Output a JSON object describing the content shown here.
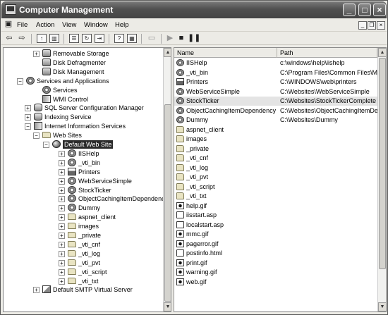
{
  "window": {
    "title": "Computer Management"
  },
  "menu": [
    "File",
    "Action",
    "View",
    "Window",
    "Help"
  ],
  "tree": [
    {
      "label": "Removable Storage",
      "icon": "drive-icon",
      "depth": 2,
      "toggle": "+"
    },
    {
      "label": "Disk Defragmenter",
      "icon": "drive-icon",
      "depth": 2,
      "toggle": ""
    },
    {
      "label": "Disk Management",
      "icon": "drive-icon",
      "depth": 2,
      "toggle": ""
    },
    {
      "label": "Services and Applications",
      "icon": "gear-icon",
      "depth": 0,
      "toggle": "−"
    },
    {
      "label": "Services",
      "icon": "gear-icon",
      "depth": 2,
      "toggle": ""
    },
    {
      "label": "WMI Control",
      "icon": "server-icon",
      "depth": 2,
      "toggle": ""
    },
    {
      "label": "SQL Server Configuration Manager",
      "icon": "db-icon",
      "depth": 1,
      "toggle": "+"
    },
    {
      "label": "Indexing Service",
      "icon": "db-icon",
      "depth": 1,
      "toggle": "+"
    },
    {
      "label": "Internet Information Services",
      "icon": "server-icon",
      "depth": 1,
      "toggle": "−"
    },
    {
      "label": "Web Sites",
      "icon": "folder-icon",
      "depth": 2,
      "toggle": "−"
    },
    {
      "label": "Default Web Site",
      "icon": "globe-icon",
      "depth": 3,
      "toggle": "−",
      "selected": true
    },
    {
      "label": "IISHelp",
      "icon": "gear-icon",
      "depth": 4,
      "toggle": "+"
    },
    {
      "label": "_vti_bin",
      "icon": "gear-icon",
      "depth": 4,
      "toggle": "+"
    },
    {
      "label": "Printers",
      "icon": "printer-icon",
      "depth": 4,
      "toggle": "+"
    },
    {
      "label": "WebServiceSimple",
      "icon": "gear-icon",
      "depth": 4,
      "toggle": "+"
    },
    {
      "label": "StockTicker",
      "icon": "gear-icon",
      "depth": 4,
      "toggle": "+"
    },
    {
      "label": "ObjectCachingItemDependency",
      "icon": "gear-icon",
      "depth": 4,
      "toggle": "+"
    },
    {
      "label": "Dummy",
      "icon": "gear-icon",
      "depth": 4,
      "toggle": "+"
    },
    {
      "label": "aspnet_client",
      "icon": "folder-icon",
      "depth": 4,
      "toggle": "+"
    },
    {
      "label": "images",
      "icon": "folder-icon",
      "depth": 4,
      "toggle": "+"
    },
    {
      "label": "_private",
      "icon": "folder-icon",
      "depth": 4,
      "toggle": "+"
    },
    {
      "label": "_vti_cnf",
      "icon": "folder-icon",
      "depth": 4,
      "toggle": "+"
    },
    {
      "label": "_vti_log",
      "icon": "folder-icon",
      "depth": 4,
      "toggle": "+"
    },
    {
      "label": "_vti_pvt",
      "icon": "folder-icon",
      "depth": 4,
      "toggle": "+"
    },
    {
      "label": "_vti_script",
      "icon": "folder-icon",
      "depth": 4,
      "toggle": "+"
    },
    {
      "label": "_vti_txt",
      "icon": "folder-icon",
      "depth": 4,
      "toggle": "+"
    },
    {
      "label": "Default SMTP Virtual Server",
      "icon": "mail-icon",
      "depth": 2,
      "toggle": "+"
    }
  ],
  "list": {
    "columns": [
      "Name",
      "Path"
    ],
    "rows": [
      {
        "name": "IISHelp",
        "path": "c:\\windows\\help\\iishelp",
        "icon": "gear-icon"
      },
      {
        "name": "_vti_bin",
        "path": "C:\\Program Files\\Common Files\\Mic",
        "icon": "gear-icon"
      },
      {
        "name": "Printers",
        "path": "C:\\WINDOWS\\web\\printers",
        "icon": "printer-icon"
      },
      {
        "name": "WebServiceSimple",
        "path": "C:\\Websites\\WebServiceSimple",
        "icon": "gear-icon"
      },
      {
        "name": "StockTicker",
        "path": "C:\\Websites\\StockTickerComplete",
        "icon": "gear-icon",
        "highlight": true
      },
      {
        "name": "ObjectCachingItemDependency",
        "path": "C:\\Websites\\ObjectCachingItemDe",
        "icon": "gear-icon"
      },
      {
        "name": "Dummy",
        "path": "C:\\Websites\\Dummy",
        "icon": "gear-icon"
      },
      {
        "name": "aspnet_client",
        "path": "",
        "icon": "folder-icon"
      },
      {
        "name": "images",
        "path": "",
        "icon": "folder-icon"
      },
      {
        "name": "_private",
        "path": "",
        "icon": "folder-icon"
      },
      {
        "name": "_vti_cnf",
        "path": "",
        "icon": "folder-icon"
      },
      {
        "name": "_vti_log",
        "path": "",
        "icon": "folder-icon"
      },
      {
        "name": "_vti_pvt",
        "path": "",
        "icon": "folder-icon"
      },
      {
        "name": "_vti_script",
        "path": "",
        "icon": "folder-icon"
      },
      {
        "name": "_vti_txt",
        "path": "",
        "icon": "folder-icon"
      },
      {
        "name": "help.gif",
        "path": "",
        "icon": "image-file-icon"
      },
      {
        "name": "iisstart.asp",
        "path": "",
        "icon": "document-icon"
      },
      {
        "name": "localstart.asp",
        "path": "",
        "icon": "document-icon"
      },
      {
        "name": "mmc.gif",
        "path": "",
        "icon": "image-file-icon"
      },
      {
        "name": "pagerror.gif",
        "path": "",
        "icon": "image-file-icon"
      },
      {
        "name": "postinfo.html",
        "path": "",
        "icon": "document-icon"
      },
      {
        "name": "print.gif",
        "path": "",
        "icon": "image-file-icon"
      },
      {
        "name": "warning.gif",
        "path": "",
        "icon": "image-file-icon"
      },
      {
        "name": "web.gif",
        "path": "",
        "icon": "image-file-icon"
      }
    ]
  }
}
